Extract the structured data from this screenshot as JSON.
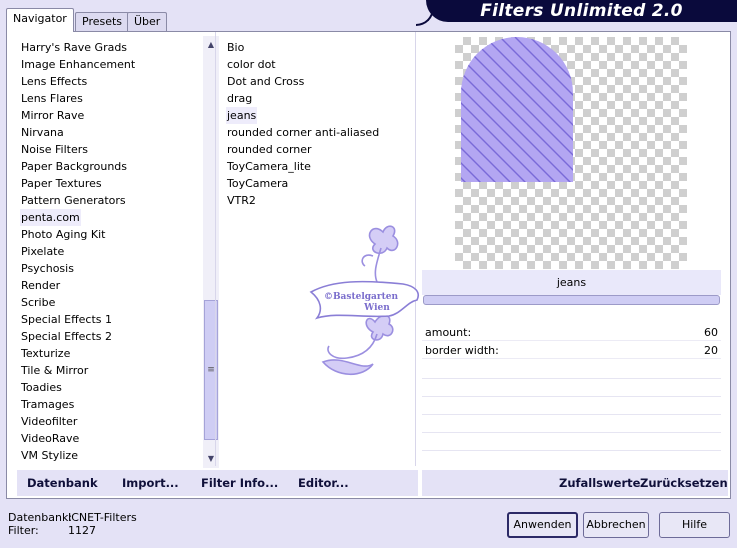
{
  "tabs": [
    {
      "label": "Navigator",
      "active": true
    },
    {
      "label": "Presets",
      "active": false
    },
    {
      "label": "Über",
      "active": false
    }
  ],
  "banner": {
    "title": "Filters Unlimited 2.0"
  },
  "categories": [
    "Harry's Rave Grads",
    "Image Enhancement",
    "Lens Effects",
    "Lens Flares",
    "Mirror Rave",
    "Nirvana",
    "Noise Filters",
    "Paper Backgrounds",
    "Paper Textures",
    "Pattern Generators",
    "penta.com",
    "Photo Aging Kit",
    "Pixelate",
    "Psychosis",
    "Render",
    "Scribe",
    "Special Effects 1",
    "Special Effects 2",
    "Texturize",
    "Tile & Mirror",
    "Toadies",
    "Tramages",
    "Videofilter",
    "VideoRave",
    "VM Stylize"
  ],
  "selected_category": "penta.com",
  "filters": [
    "Bio",
    "color dot",
    "Dot and Cross",
    "drag",
    "jeans",
    "rounded corner anti-aliased",
    "rounded corner",
    "ToyCamera_lite",
    "ToyCamera",
    "VTR2"
  ],
  "selected_filter": "jeans",
  "watermark": {
    "line1": "©Bastelgarten",
    "line2": "Wien"
  },
  "preview": {
    "shape_color": "#b3a6f2",
    "stripe_color": "#7a6ad8"
  },
  "params": {
    "filter_name": "jeans",
    "rows": [
      {
        "label": "amount:",
        "value": "60"
      },
      {
        "label": "border width:",
        "value": "20"
      }
    ]
  },
  "left_actions": {
    "database": "Datenbank",
    "import": "Import...",
    "filter_info": "Filter Info...",
    "editor": "Editor..."
  },
  "right_actions": {
    "random": "Zufallswerte",
    "reset": "Zurücksetzen"
  },
  "status": {
    "db_label": "Datenbank:",
    "db_value": "ICNET-Filters",
    "filter_label": "Filter:",
    "filter_value": "1127"
  },
  "buttons": {
    "apply": "Anwenden",
    "cancel": "Abbrechen",
    "help": "Hilfe"
  }
}
